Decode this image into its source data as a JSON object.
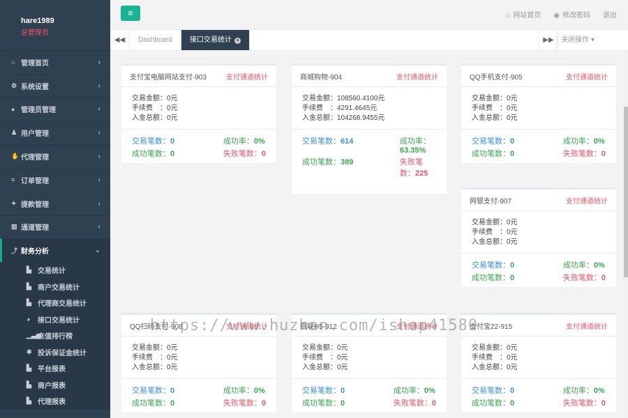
{
  "profile": {
    "name": "hare1989",
    "role": "总管理员"
  },
  "sidebar": {
    "items": [
      {
        "label": "管理首页",
        "icon": "home-icon",
        "glyph": "⌂"
      },
      {
        "label": "系统设置",
        "icon": "gears-icon",
        "glyph": "⚙"
      },
      {
        "label": "管理员管理",
        "icon": "user-icon",
        "glyph": "●"
      },
      {
        "label": "用户管理",
        "icon": "users-icon",
        "glyph": "♟"
      },
      {
        "label": "代理管理",
        "icon": "handshake-icon",
        "glyph": "✋"
      },
      {
        "label": "订单管理",
        "icon": "list-icon",
        "glyph": "≡"
      },
      {
        "label": "提款管理",
        "icon": "money-bag-icon",
        "glyph": "✦"
      },
      {
        "label": "通道管理",
        "icon": "bank-icon",
        "glyph": "▥"
      },
      {
        "label": "财务分析",
        "icon": "chart-icon",
        "glyph": "⤴"
      }
    ],
    "subitems": [
      {
        "label": "交易统计",
        "icon": "bar-chart-icon",
        "glyph": "▙"
      },
      {
        "label": "商户交易统计",
        "icon": "bar-chart-icon",
        "glyph": "▙"
      },
      {
        "label": "代理商交易统计",
        "icon": "bar-chart-icon",
        "glyph": "▙"
      },
      {
        "label": "接口交易统计",
        "icon": "pie-chart-icon",
        "glyph": "◕"
      },
      {
        "label": "充值排行榜",
        "icon": "signal-icon",
        "glyph": "▁▃▅"
      },
      {
        "label": "投诉保证金统计",
        "icon": "asterisk-icon",
        "glyph": "✱"
      },
      {
        "label": "平台报表",
        "icon": "bar-chart-icon",
        "glyph": "▙"
      },
      {
        "label": "商户报表",
        "icon": "bar-chart-icon",
        "glyph": "▙"
      },
      {
        "label": "代理报表",
        "icon": "bar-chart-icon",
        "glyph": "▙"
      }
    ]
  },
  "topbar": {
    "home": "网站首页",
    "password": "修改密码",
    "logout": "退出"
  },
  "tabs": {
    "dashboard": "Dashboard",
    "active": "接口交易统计",
    "close_ops": "关闭操作"
  },
  "labels": {
    "amount": "交易金额：",
    "fee": "手续费　：",
    "income": "入金总额：",
    "count": "交易笔数：",
    "success_count": "成功笔数：",
    "success_rate": "成功率：",
    "fail_count": "失败笔数：",
    "link": "支付通道统计"
  },
  "cards": [
    {
      "title": "支付宝电脑网站支付-903",
      "amount": "0元",
      "fee": "0元",
      "income": "0元",
      "count": "0",
      "success": "0",
      "rate": "0%",
      "fail": "0"
    },
    {
      "title": "商城购物-904",
      "amount": "108560.4100元",
      "fee": "4291.4645元",
      "income": "104268.9455元",
      "count": "614",
      "success": "389",
      "rate": "63.35%",
      "fail": "225"
    },
    {
      "title": "QQ手机支付-905",
      "amount": "0元",
      "fee": "0元",
      "income": "0元",
      "count": "0",
      "success": "0",
      "rate": "0%",
      "fail": "0"
    },
    {
      "title": "网银支付-907",
      "amount": "0元",
      "fee": "0元",
      "income": "0元",
      "count": "0",
      "success": "0",
      "rate": "0%",
      "fail": "0"
    },
    {
      "title": "QQ扫码支付-908",
      "amount": "0元",
      "fee": "0元",
      "income": "0元",
      "count": "0",
      "success": "0",
      "rate": "0%",
      "fail": "0"
    },
    {
      "title": "银联H5-912",
      "amount": "0元",
      "fee": "0元",
      "income": "0元",
      "count": "0",
      "success": "0",
      "rate": "0%",
      "fail": "0"
    },
    {
      "title": "支付宝22-915",
      "amount": "0元",
      "fee": "0元",
      "income": "0元",
      "count": "0",
      "success": "0",
      "rate": "0%",
      "fail": "0"
    }
  ],
  "watermark": "https://www.huzhan.com/ishop41580"
}
